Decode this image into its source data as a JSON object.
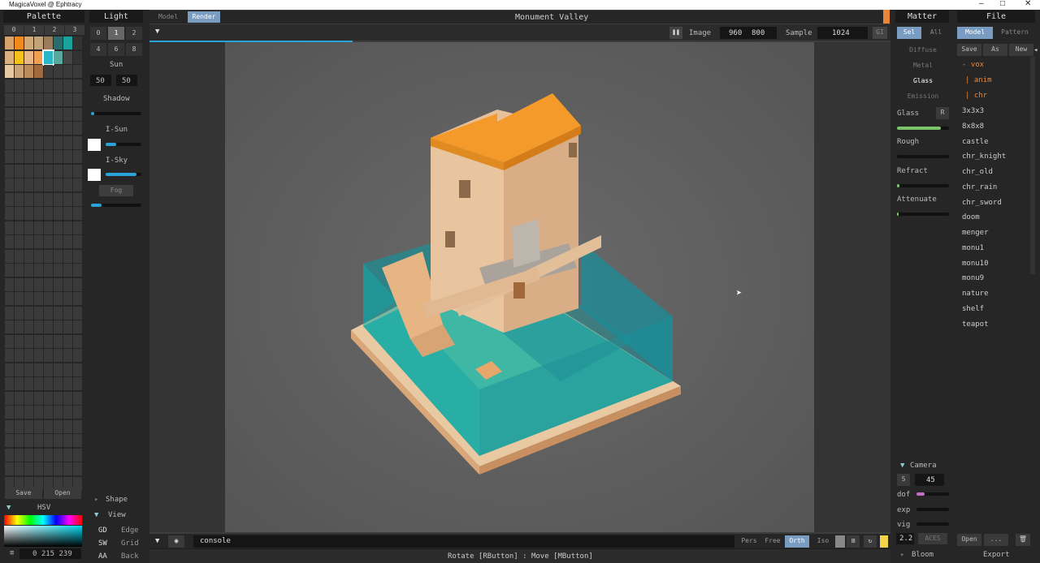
{
  "window": {
    "title": "MagicaVoxel @ Ephtracy",
    "min": "–",
    "max": "□",
    "close": "✕"
  },
  "palette": {
    "header": "Palette",
    "tabs": [
      "0",
      "1",
      "2",
      "3"
    ],
    "save": "Save",
    "open": "Open",
    "mode": "HSV",
    "value": "0 215 239",
    "swatch_colors": [
      "#d6a26b",
      "#f08a1c",
      "#cfa978",
      "#bfa37a",
      "#9c7b5a",
      "#2a6b6b",
      "#1aa39a",
      "#333",
      "#d9b07e",
      "#f2c21a",
      "#e8b889",
      "#f0a050",
      "#2bb6c7",
      "#58a89c",
      "#444",
      "#333",
      "#e6c9a3",
      "#c9a47a",
      "#b98b59",
      "#a06a3e",
      "#3a3a3a",
      "#3a3a3a",
      "#3a3a3a",
      "#3a3a3a"
    ]
  },
  "light": {
    "header": "Light",
    "slots": [
      "0",
      "1",
      "2",
      "4",
      "6",
      "8"
    ],
    "active_slot": "1",
    "sun_label": "Sun",
    "sun_values": [
      "50",
      "50"
    ],
    "shadow": "Shadow",
    "isun": "I-Sun",
    "isky": "I-Sky",
    "fog": "Fog",
    "shape": "Shape",
    "view": "View",
    "view_rows": [
      {
        "k": "GD",
        "v": "Edge"
      },
      {
        "k": "SW",
        "v": "Grid"
      },
      {
        "k": "AA",
        "v": "Back"
      }
    ]
  },
  "topbar": {
    "model_tab": "Model",
    "render_tab": "Render",
    "title": "Monument Valley",
    "image_label": "Image",
    "image_w": "960",
    "image_h": "800",
    "sample_label": "Sample",
    "sample_value": "1024",
    "gi": "GI",
    "pause_icon": "pause-icon"
  },
  "bottombar": {
    "console": "console",
    "status": "Rotate [RButton] : Move [MButton]",
    "modes": [
      "Pers",
      "Free",
      "Orth",
      "Iso"
    ],
    "active_mode": "Orth"
  },
  "matter": {
    "header": "Matter",
    "sel": "Sel",
    "all": "All",
    "types": [
      "Diffuse",
      "Metal",
      "Glass",
      "Emission"
    ],
    "active_type": "Glass",
    "glass_label": "Glass",
    "r": "R",
    "rough": "Rough",
    "refract": "Refract",
    "attenuate": "Attenuate",
    "glass_level": 0.85,
    "camera": "Camera",
    "s": "S",
    "fov": "45",
    "dof": "dof",
    "exp": "exp",
    "vig": "vig",
    "gamma": "2.2",
    "aces": "ACES",
    "bloom": "Bloom"
  },
  "file": {
    "header": "File",
    "model_tab": "Model",
    "pattern_tab": "Pattern",
    "save": "Save",
    "as": "As",
    "new": "New",
    "tree": [
      "- vox",
      "| anim",
      "| chr"
    ],
    "files": [
      "3x3x3",
      "8x8x8",
      "castle",
      "chr_knight",
      "chr_old",
      "chr_rain",
      "chr_sword",
      "doom",
      "menger",
      "monu1",
      "monu10",
      "monu9",
      "nature",
      "shelf",
      "teapot"
    ],
    "open": "Open",
    "more": "...",
    "export": "Export"
  }
}
